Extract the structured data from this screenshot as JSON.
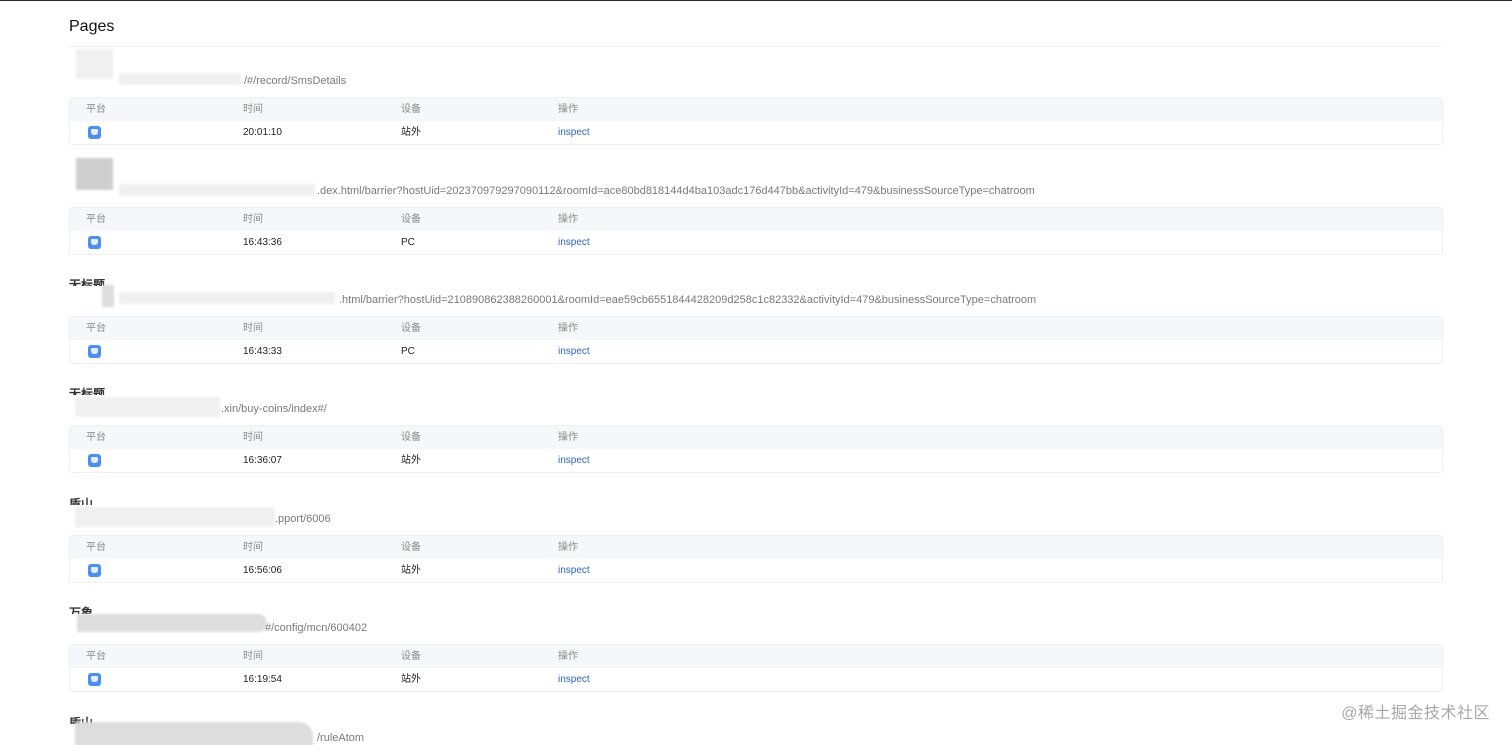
{
  "page": {
    "title": "Pages"
  },
  "table_headers": {
    "platform": "平台",
    "time": "时间",
    "device": "设备",
    "action": "操作"
  },
  "entries": [
    {
      "name": "",
      "url": "/#/record/SmsDetails",
      "time": "20:01:10",
      "device": "站外",
      "action": "inspect",
      "platform_icon": "browser-icon"
    },
    {
      "name": "",
      "url": ".dex.html/barrier?hostUid=202370979297090112&roomId=ace80bd818144d4ba103adc176d447bb&activityId=479&businessSourceType=chatroom",
      "time": "16:43:36",
      "device": "PC",
      "action": "inspect",
      "platform_icon": "browser-icon"
    },
    {
      "name": "无标题",
      "url": ".html/barrier?hostUid=210890862388260001&roomId=eae59cb6551844428209d258c1c82332&activityId=479&businessSourceType=chatroom",
      "time": "16:43:33",
      "device": "PC",
      "action": "inspect",
      "platform_icon": "browser-icon"
    },
    {
      "name": "无标题",
      "url": ".xin/buy-coins/index#/",
      "time": "16:36:07",
      "device": "站外",
      "action": "inspect",
      "platform_icon": "browser-icon"
    },
    {
      "name": "盾山",
      "url": ".pport/6006",
      "time": "16:56:06",
      "device": "站外",
      "action": "inspect",
      "platform_icon": "browser-icon"
    },
    {
      "name": "万象",
      "url": "#/config/mcn/600402",
      "time": "16:19:54",
      "device": "站外",
      "action": "inspect",
      "platform_icon": "browser-icon"
    },
    {
      "name": "盾山",
      "url": "/ruleAtom"
    }
  ],
  "watermark": "@稀土掘金技术社区"
}
